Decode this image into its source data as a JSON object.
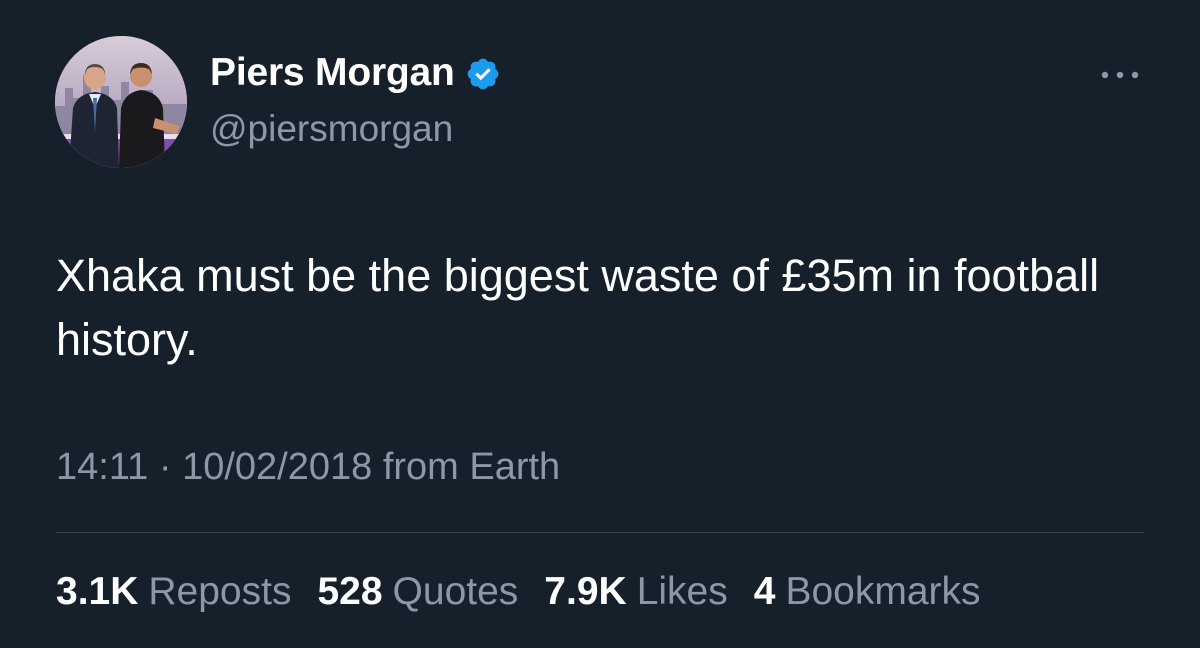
{
  "user": {
    "display_name": "Piers Morgan",
    "handle": "@piersmorgan",
    "verified": true,
    "verified_color": "#1d9bf0"
  },
  "tweet": {
    "text": "Xhaka must be the biggest waste of £35m in football history.",
    "time": "14:11",
    "separator": "·",
    "date": "10/02/2018",
    "source": "from Earth"
  },
  "stats": [
    {
      "count": "3.1K",
      "label": "Reposts"
    },
    {
      "count": "528",
      "label": "Quotes"
    },
    {
      "count": "7.9K",
      "label": "Likes"
    },
    {
      "count": "4",
      "label": "Bookmarks"
    }
  ],
  "colors": {
    "background": "#15202b",
    "primary_text": "#ffffff",
    "secondary_text": "#8b98a5",
    "divider": "#38444d"
  },
  "icons": {
    "verified": "verified-badge-icon",
    "more": "more-options-icon"
  }
}
